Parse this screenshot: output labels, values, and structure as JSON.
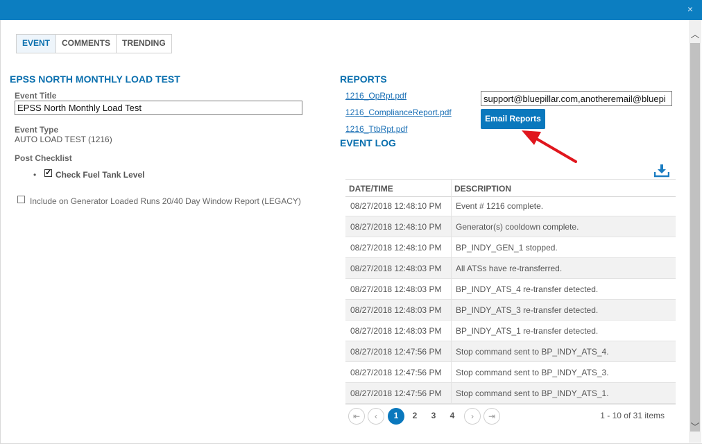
{
  "window": {
    "close_glyph": "×"
  },
  "tabs": [
    "EVENT",
    "COMMENTS",
    "TRENDING"
  ],
  "event": {
    "section_title": "EPSS NORTH MONTHLY LOAD TEST",
    "title_label": "Event Title",
    "title_value": "EPSS North Monthly Load Test",
    "type_label": "Event Type",
    "type_value": "AUTO LOAD TEST (1216)",
    "checklist_label": "Post Checklist",
    "checklist_item": "Check Fuel Tank Level",
    "checklist_bullet": "•",
    "include_label": "Include on Generator Loaded Runs 20/40 Day Window Report (LEGACY)"
  },
  "reports": {
    "section_title": "REPORTS",
    "files": [
      "1216_OpRpt.pdf",
      "1216_ComplianceReport.pdf",
      "1216_TtbRpt.pdf"
    ],
    "email_value": "support@bluepillar.com,anotheremail@bluepi",
    "email_button": "Email Reports"
  },
  "event_log": {
    "section_title": "EVENT LOG",
    "columns": [
      "DATE/TIME",
      "DESCRIPTION"
    ],
    "rows": [
      [
        "08/27/2018 12:48:10 PM",
        "Event # 1216 complete."
      ],
      [
        "08/27/2018 12:48:10 PM",
        "Generator(s) cooldown complete."
      ],
      [
        "08/27/2018 12:48:10 PM",
        "BP_INDY_GEN_1 stopped."
      ],
      [
        "08/27/2018 12:48:03 PM",
        "All ATSs have re-transferred."
      ],
      [
        "08/27/2018 12:48:03 PM",
        "BP_INDY_ATS_4 re-transfer detected."
      ],
      [
        "08/27/2018 12:48:03 PM",
        "BP_INDY_ATS_3 re-transfer detected."
      ],
      [
        "08/27/2018 12:48:03 PM",
        "BP_INDY_ATS_1 re-transfer detected."
      ],
      [
        "08/27/2018 12:47:56 PM",
        "Stop command sent to BP_INDY_ATS_4."
      ],
      [
        "08/27/2018 12:47:56 PM",
        "Stop command sent to BP_INDY_ATS_3."
      ],
      [
        "08/27/2018 12:47:56 PM",
        "Stop command sent to BP_INDY_ATS_1."
      ]
    ],
    "pager": {
      "first": "⇤",
      "prev": "‹",
      "next": "›",
      "last": "⇥",
      "pages": [
        "1",
        "2",
        "3",
        "4"
      ],
      "current": "1",
      "info": "1 - 10 of 31 items"
    }
  },
  "scrollbar": {
    "up": "︿",
    "down": "﹀"
  },
  "colors": {
    "accent": "#0a78bd",
    "annotation_arrow": "#e0161d"
  }
}
